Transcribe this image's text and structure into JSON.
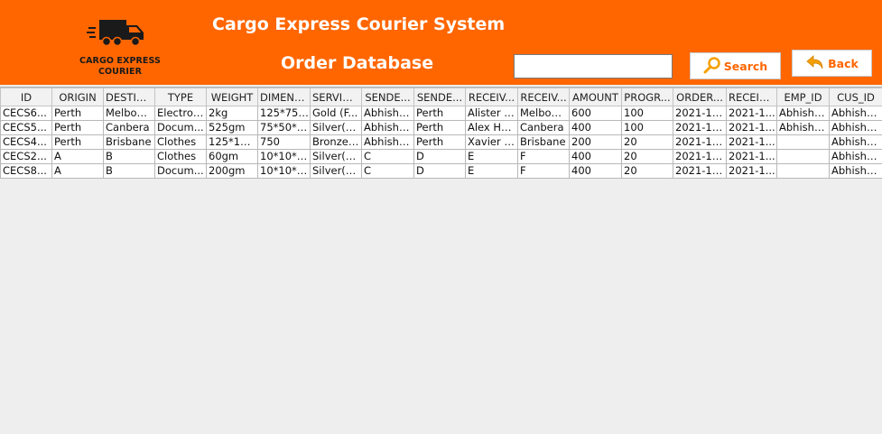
{
  "header": {
    "logo_line1": "CARGO EXPRESS",
    "logo_line2": "COURIER",
    "app_title": "Cargo Express Courier System",
    "page_title": "Order Database",
    "background_color": "#ff6600"
  },
  "toolbar": {
    "search_value": "",
    "search_label": "Search",
    "search_icon": "magnifier-icon",
    "back_label": "Back",
    "back_icon": "back-arrow-icon"
  },
  "table": {
    "columns": [
      "ID",
      "ORIGIN",
      "DESTIN...",
      "TYPE",
      "WEIGHT",
      "DIMENS...",
      "SERVIC...",
      "SENDE...",
      "SENDE...",
      "RECEIV...",
      "RECEIV...",
      "AMOUNT",
      "PROGR...",
      "ORDER...",
      "RECEIV...",
      "EMP_ID",
      "CUS_ID"
    ],
    "rows": [
      [
        "CECS6...",
        "Perth",
        "Melbour...",
        "Electron...",
        "2kg",
        "125*75*...",
        "Gold (F...",
        "Abhishe...",
        "Perth",
        "Alister C...",
        "Melbour...",
        "600",
        "100",
        "2021-11...",
        "2021-1...",
        "Abhishe...",
        "Abhishe..."
      ],
      [
        "CECS5...",
        "Perth",
        "Canbera",
        "Docum...",
        "525gm",
        "75*50*10",
        "Silver(M...",
        "Abhishe...",
        "Perth",
        "Alex Hal...",
        "Canbera",
        "400",
        "100",
        "2021-11...",
        "2021-1...",
        "Abhishe...",
        "Abhishe..."
      ],
      [
        "CECS4...",
        "Perth",
        "Brisbane",
        "Clothes",
        "125*10...",
        "750",
        "Bronze(...",
        "Abhishe...",
        "Perth",
        "Xavier S...",
        "Brisbane",
        "200",
        "20",
        "2021-11...",
        "2021-1...",
        "",
        "Abhishe..."
      ],
      [
        "CECS2...",
        "A",
        "B",
        "Clothes",
        "60gm",
        "10*10*10",
        "Silver(M...",
        "C",
        "D",
        "E",
        "F",
        "400",
        "20",
        "2021-11...",
        "2021-1...",
        "",
        "Abhishe..."
      ],
      [
        "CECS8...",
        "A",
        "B",
        "Docum...",
        "200gm",
        "10*10*10",
        "Silver(M...",
        "C",
        "D",
        "E",
        "F",
        "400",
        "20",
        "2021-12...",
        "2021-1...",
        "",
        "Abhishe..."
      ]
    ]
  }
}
